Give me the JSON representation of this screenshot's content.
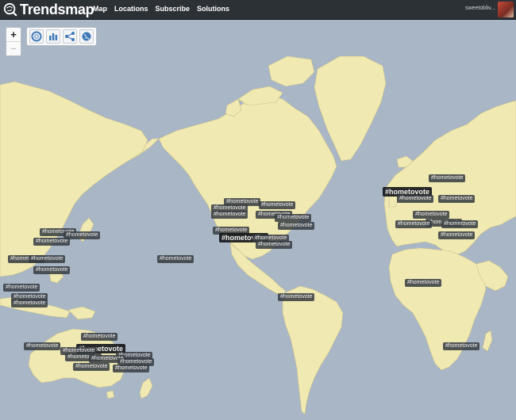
{
  "app": {
    "logo_text": "Trendsmap"
  },
  "nav": [
    {
      "label": "Map"
    },
    {
      "label": "Locations"
    },
    {
      "label": "Subscribe"
    },
    {
      "label": "Solutions"
    }
  ],
  "user": {
    "name": "sweetobliv..."
  },
  "map_controls": {
    "zoom_in": "+",
    "zoom_out": "−",
    "tools": [
      {
        "icon": "lifebuoy-icon"
      },
      {
        "icon": "bar-chart-icon"
      },
      {
        "icon": "share-icon"
      },
      {
        "icon": "globe-icon"
      }
    ]
  },
  "colors": {
    "ocean": "#a8b6c6",
    "land": "#f1e9b2",
    "topbar": "#2c3136"
  },
  "trend_tag": "#hometovote",
  "trend_tag_count": 43
}
